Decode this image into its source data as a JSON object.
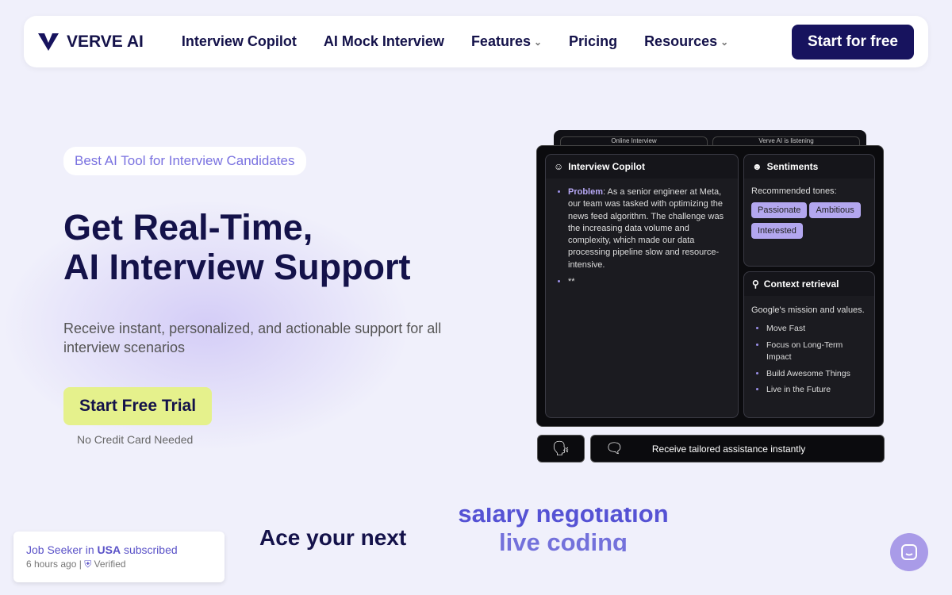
{
  "nav": {
    "brand": "VERVE AI",
    "links": [
      {
        "label": "Interview Copilot"
      },
      {
        "label": "AI Mock Interview"
      },
      {
        "label": "Features",
        "dropdown": true
      },
      {
        "label": "Pricing"
      },
      {
        "label": "Resources",
        "dropdown": true
      }
    ],
    "cta": "Start for free"
  },
  "hero": {
    "badge": "Best AI Tool for Interview Candidates",
    "title_line1": "Get Real-Time,",
    "title_line2": "AI Interview Support",
    "subtitle": "Receive instant, personalized, and actionable support for all interview scenarios",
    "trial_button": "Start Free Trial",
    "note": "No Credit Card Needed"
  },
  "demo": {
    "back_tabs": [
      "Online Interview",
      "Verve AI is listening"
    ],
    "copilot": {
      "title": "Interview Copilot",
      "problem_label": "Problem",
      "problem_text": ": As a senior engineer at Meta, our team was tasked with optimizing the news feed algorithm. The challenge was the increasing data volume and complexity, which made our data processing pipeline slow and resource-intensive.",
      "second_bullet": "**"
    },
    "sentiments": {
      "title": "Sentiments",
      "label": "Recommended tones:",
      "tags": [
        "Passionate",
        "Ambitious",
        "Interested"
      ]
    },
    "context": {
      "title": "Context retrieval",
      "heading": "Google's mission and values.",
      "items": [
        "Move Fast",
        "Focus on Long-Term Impact",
        "Build Awesome Things",
        "Live in the Future"
      ]
    },
    "assist_text": "Receive tailored assistance instantly"
  },
  "toast": {
    "prefix": "Job Seeker in ",
    "country": "USA",
    "suffix": " subscribed",
    "time": "6 hours ago",
    "verified": "Verified"
  },
  "ace": {
    "lead": "Ace your next",
    "rotating": [
      "salary negotiation",
      "live coding"
    ]
  },
  "colors": {
    "brand_dark": "#17135e",
    "accent": "#5552d4",
    "trial": "#e5f18c"
  }
}
